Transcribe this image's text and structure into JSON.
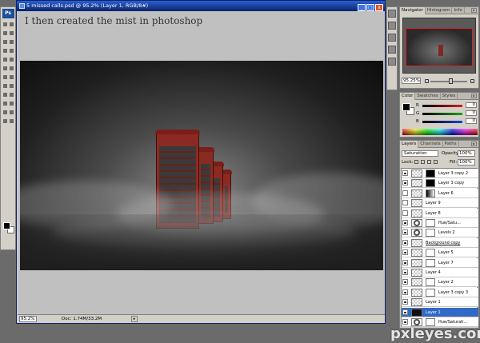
{
  "toolbox": {
    "logo": "Ps",
    "tool_icons": [
      "move-icon",
      "marquee-icon",
      "lasso-icon",
      "magic-wand-icon",
      "crop-icon",
      "slice-icon",
      "healing-icon",
      "brush-icon",
      "clone-stamp-icon",
      "history-brush-icon",
      "eraser-icon",
      "gradient-icon",
      "blur-icon",
      "dodge-icon",
      "path-select-icon",
      "type-icon",
      "pen-icon",
      "shape-icon",
      "notes-icon",
      "eyedropper-icon",
      "hand-icon",
      "zoom-icon",
      "quickmask-icon",
      "screen-mode-icon"
    ],
    "foreground_color": "#000000",
    "background_color": "#ffffff"
  },
  "document": {
    "title": "5 missed calls.psd @ 95.2% (Layer 1, RGB/8#)",
    "caption": "I then created the mist in photoshop",
    "zoom": "95.2%",
    "doc_info": "Doc: 1.74M/33.2M",
    "window_buttons": [
      "_",
      "□",
      "x"
    ]
  },
  "navigator": {
    "tabs": [
      "Navigator",
      "Histogram",
      "Info"
    ],
    "active_tab": "Navigator",
    "zoom": "95.25%",
    "zoom_slider_fraction": 0.55
  },
  "color": {
    "tabs": [
      "Color",
      "Swatches",
      "Styles"
    ],
    "active_tab": "Color",
    "channels": [
      {
        "label": "R",
        "value": "0",
        "color": "#d02020"
      },
      {
        "label": "G",
        "value": "0",
        "color": "#20a020"
      },
      {
        "label": "B",
        "value": "0",
        "color": "#2040d0"
      }
    ]
  },
  "layers": {
    "tabs": [
      "Layers",
      "Channels",
      "Paths"
    ],
    "active_tab": "Layers",
    "blend_mode": "Saturation",
    "opacity_label": "Opacity:",
    "opacity": "100%",
    "lock_label": "Lock:",
    "fill_label": "Fill:",
    "fill": "100%",
    "items": [
      {
        "name": "Layer 3 copy 2",
        "visible": true,
        "thumb": "checker",
        "mask": "black",
        "selected": false
      },
      {
        "name": "Layer 3 copy",
        "visible": true,
        "thumb": "checker",
        "mask": "black",
        "selected": false
      },
      {
        "name": "Layer 6",
        "visible": false,
        "thumb": "checker",
        "mask": "grad",
        "selected": false
      },
      {
        "name": "Layer 9",
        "visible": false,
        "thumb": "checker",
        "mask": "",
        "selected": false
      },
      {
        "name": "Layer 8",
        "visible": false,
        "thumb": "checker",
        "mask": "",
        "selected": false
      },
      {
        "name": "Hue/Satu...",
        "visible": true,
        "thumb": "adj",
        "mask": "white",
        "selected": false
      },
      {
        "name": "Levels 2",
        "visible": true,
        "thumb": "adj",
        "mask": "white",
        "selected": false
      },
      {
        "name": "Background copy",
        "visible": true,
        "thumb": "checker",
        "mask": "",
        "selected": false
      },
      {
        "name": "Layer 5",
        "visible": true,
        "thumb": "checker",
        "mask": "white",
        "selected": false
      },
      {
        "name": "Layer 7",
        "visible": true,
        "thumb": "checker",
        "mask": "white",
        "selected": false
      },
      {
        "name": "Layer 4",
        "visible": true,
        "thumb": "checker",
        "mask": "",
        "selected": false
      },
      {
        "name": "Layer 2",
        "visible": true,
        "thumb": "checker",
        "mask": "white",
        "selected": false
      },
      {
        "name": "Layer 3 copy 3",
        "visible": true,
        "thumb": "checker",
        "mask": "white",
        "selected": false
      },
      {
        "name": "Layer 1",
        "visible": true,
        "thumb": "checker",
        "mask": "",
        "selected": false
      },
      {
        "name": "Layer 1",
        "visible": true,
        "thumb": "dark",
        "mask": "",
        "selected": true
      },
      {
        "name": "Hue/Saturati...",
        "visible": true,
        "thumb": "adj",
        "mask": "white",
        "selected": false
      }
    ]
  },
  "watermark": "pxleyes.com"
}
